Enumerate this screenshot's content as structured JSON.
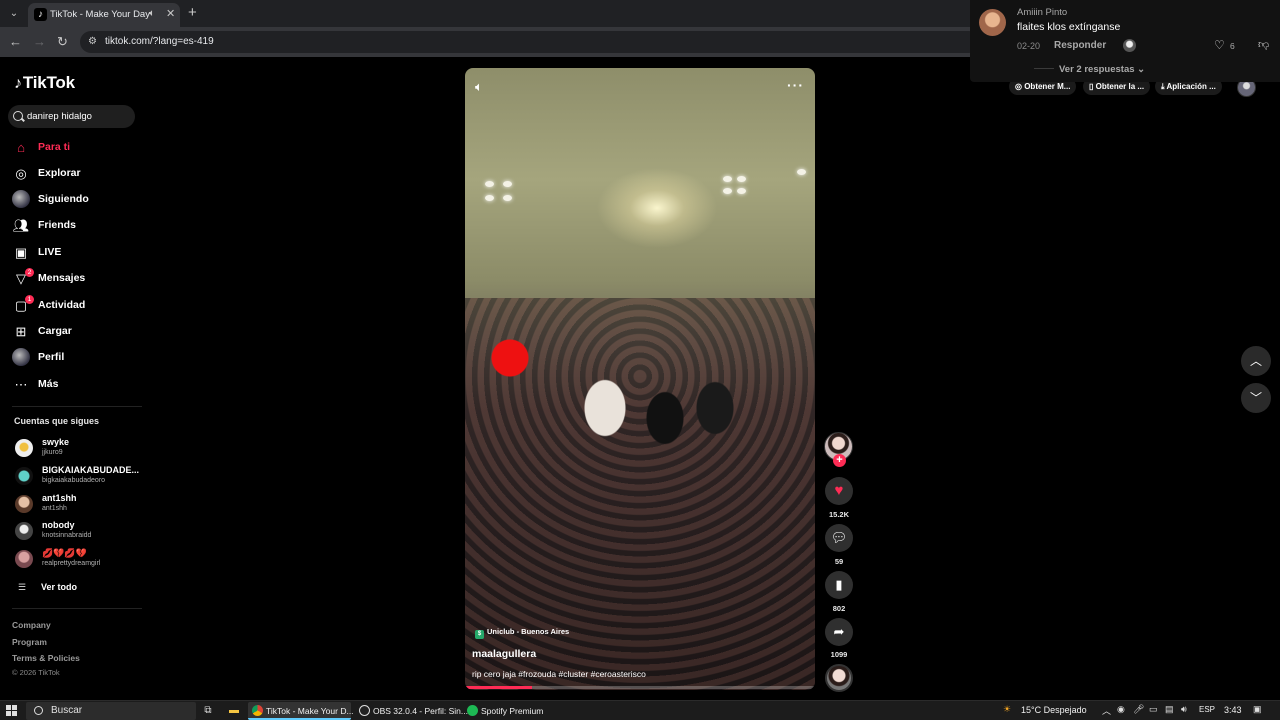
{
  "browser": {
    "tab_title": "TikTok - Make Your Day",
    "url": "tiktok.com/?lang=es-419"
  },
  "sidebar": {
    "logo": "TikTok",
    "search_value": "danirep hidalgo",
    "nav": [
      {
        "label": "Para ti",
        "icon": "home-icon",
        "active": true
      },
      {
        "label": "Explorar",
        "icon": "compass-icon"
      },
      {
        "label": "Siguiendo",
        "icon": "following-avatar-icon"
      },
      {
        "label": "Friends",
        "icon": "friends-icon"
      },
      {
        "label": "LIVE",
        "icon": "live-icon"
      },
      {
        "label": "Mensajes",
        "icon": "messages-icon",
        "badge": "2"
      },
      {
        "label": "Actividad",
        "icon": "activity-icon",
        "badge": "1"
      },
      {
        "label": "Cargar",
        "icon": "upload-icon"
      },
      {
        "label": "Perfil",
        "icon": "profile-avatar-icon"
      },
      {
        "label": "Más",
        "icon": "more-icon"
      }
    ],
    "following_title": "Cuentas que sigues",
    "following": [
      {
        "name": "swyke",
        "username": "jjkuro9"
      },
      {
        "name": "BIGKAIAKABUDADE...",
        "username": "bigkaiakabudadeoro"
      },
      {
        "name": "ant1shh",
        "username": "ant1shh"
      },
      {
        "name": "nobody",
        "username": "knotsinnabraidd"
      },
      {
        "name": "💋💔💋💔",
        "username": "realprettydreamgirl"
      }
    ],
    "see_all": "Ver todo",
    "footer": {
      "company": "Company",
      "program": "Program",
      "terms": "Terms & Policies",
      "copyright": "© 2026 TikTok"
    }
  },
  "video": {
    "location": "Uniclub - Buenos Aires",
    "author": "maalagullera",
    "caption": "rip cero jaja #frozouda #cluster #ceroasterisco",
    "progress_percent": 19
  },
  "actions": {
    "likes": "15.2K",
    "comments": "59",
    "saves": "802",
    "shares": "1099"
  },
  "comment_popup": {
    "name": "Amiiin Pinto",
    "text": "flaites klos extínganse",
    "date": "02-20",
    "reply": "Responder",
    "likes": "6",
    "view_replies": "Ver 2 respuestas"
  },
  "top_links": [
    "Obtener M...",
    "Obtener la ...",
    "Aplicación ..."
  ],
  "taskbar": {
    "search": "Buscar",
    "apps": [
      "TikTok - Make Your D...",
      "OBS 32.0.4 - Perfil: Sin...",
      "Spotify Premium"
    ],
    "weather": "15°C  Despejado",
    "lang": "ESP",
    "time": "3:43"
  },
  "colors": {
    "accent": "#fe2c55",
    "background": "#000000"
  }
}
